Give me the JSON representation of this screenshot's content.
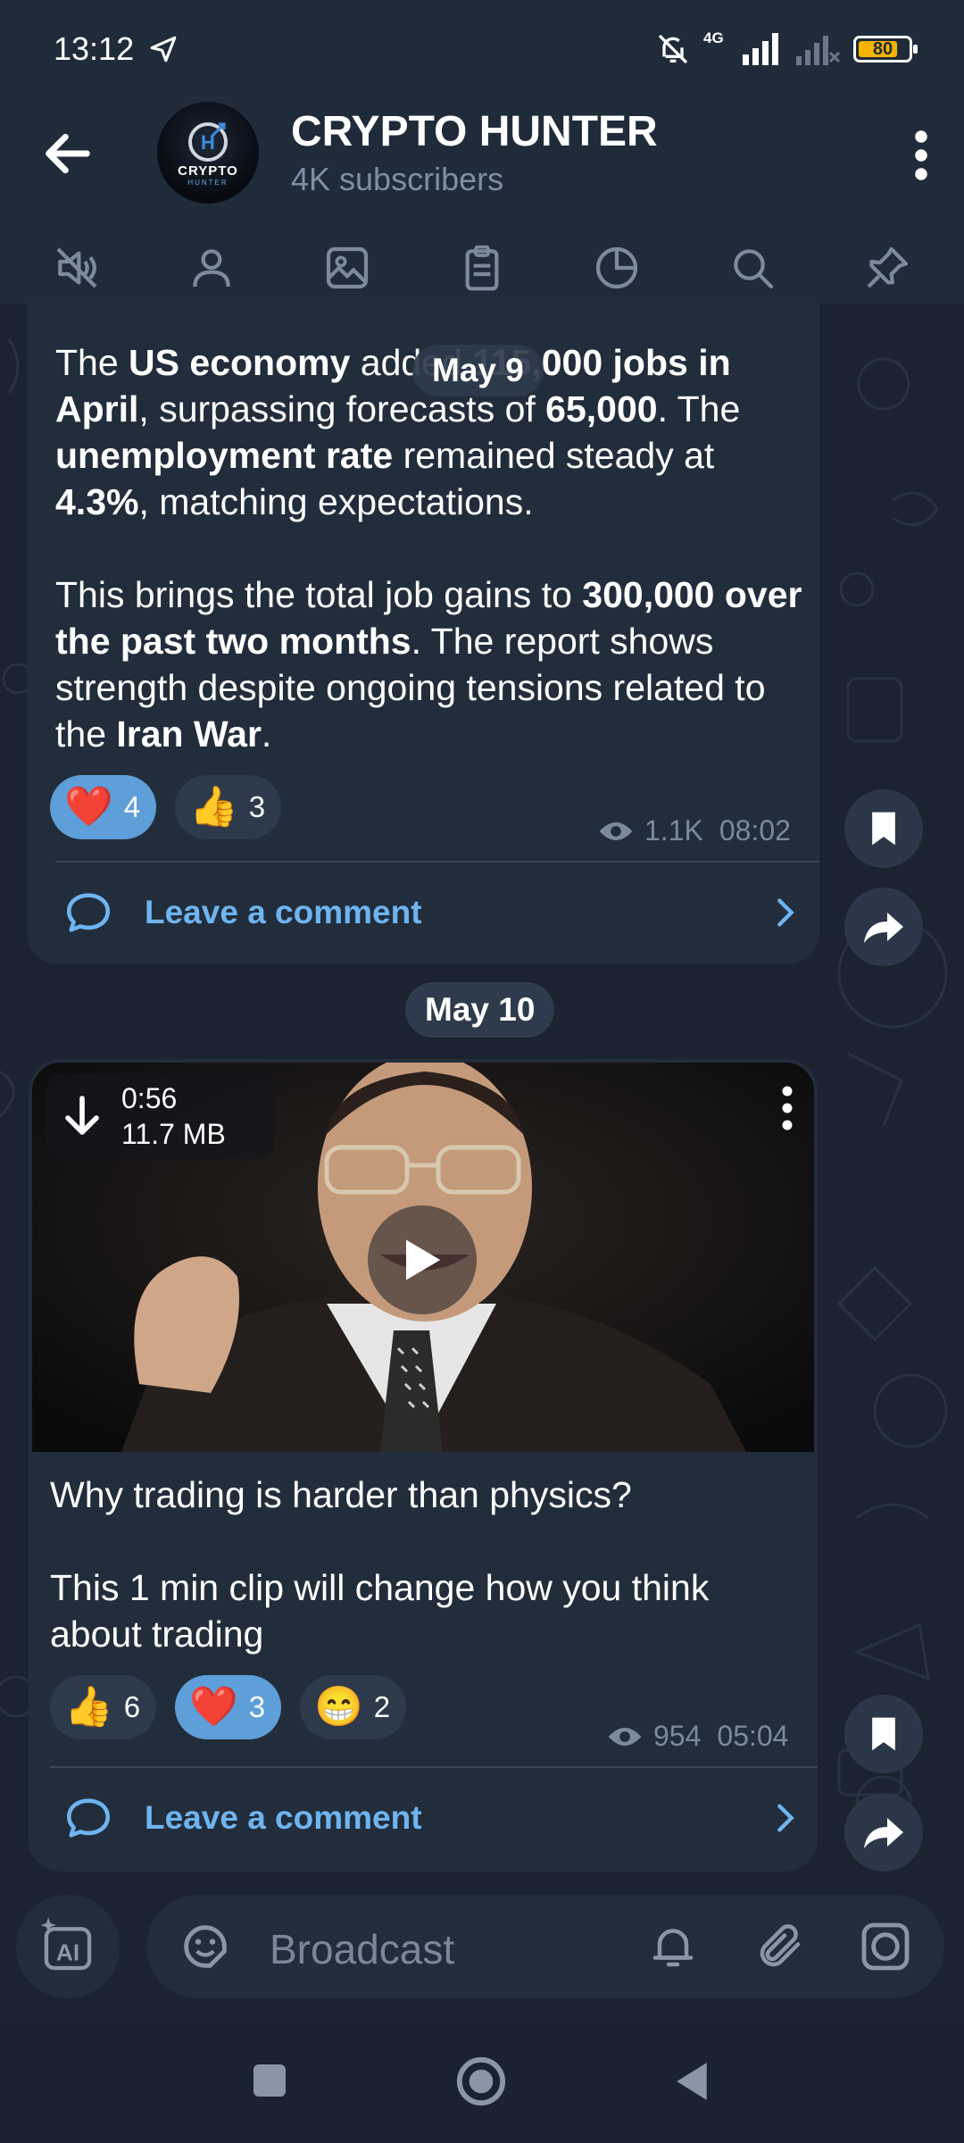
{
  "status_bar": {
    "time": "13:12",
    "network": "4G",
    "battery": "80",
    "battery_level_percent": 80
  },
  "header": {
    "title": "CRYPTO HUNTER",
    "subtitle": "4K subscribers",
    "avatar_text": "CRYPTO",
    "avatar_subtext": "HUNTER",
    "tabs": [
      "mute-icon",
      "profile-icon",
      "media-icon",
      "files-icon",
      "stats-icon",
      "search-icon",
      "pin-icon"
    ]
  },
  "messages": [
    {
      "floating_date": "May 9",
      "paragraph1": {
        "seg1": "The ",
        "seg2": "US economy",
        "seg3": " added ",
        "seg4": "115,000 jobs in April",
        "seg5": ", surpassing forecasts of ",
        "seg6": "65,000",
        "seg7": ". The ",
        "seg8": "unemployment rate",
        "seg9": " remained steady at ",
        "seg10": "4.3%",
        "seg11": ", matching expectations."
      },
      "paragraph2": {
        "seg1": "This brings the total job gains to ",
        "seg2": "300,000 over the past two months",
        "seg3": ". The report shows strength despite ongoing tensions related to the ",
        "seg4": "Iran War",
        "seg5": "."
      },
      "reactions": [
        {
          "emoji": "❤️",
          "count": "4",
          "active": true
        },
        {
          "emoji": "👍",
          "count": "3",
          "active": false
        }
      ],
      "views": "1.1K",
      "time": "08:02",
      "comment_label": "Leave a comment"
    },
    {
      "date_separator": "May 10",
      "video": {
        "duration": "0:56",
        "size": "11.7 MB"
      },
      "line1": "Why trading is harder than physics?",
      "line2": "This 1 min clip will change how you think about trading",
      "reactions": [
        {
          "emoji": "👍",
          "count": "6",
          "active": false
        },
        {
          "emoji": "❤️",
          "count": "3",
          "active": true
        },
        {
          "emoji": "😁",
          "count": "2",
          "active": false
        }
      ],
      "views": "954",
      "time": "05:04",
      "comment_label": "Leave a comment"
    }
  ],
  "input": {
    "placeholder": "Broadcast"
  },
  "colors": {
    "background": "#1b2330",
    "bubble": "#222d3b",
    "accent": "#6eb4f0",
    "active_reaction": "#5e9ed9"
  }
}
